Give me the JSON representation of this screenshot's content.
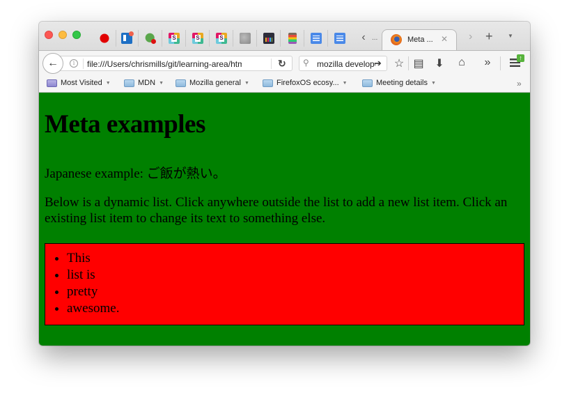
{
  "window": {
    "traffic_lights": [
      "close",
      "minimize",
      "maximize"
    ]
  },
  "tabs": {
    "pinned": [
      {
        "icon": "dinosaur-icon"
      },
      {
        "icon": "trello-icon"
      },
      {
        "icon": "bug-icon"
      },
      {
        "icon": "slack-icon"
      },
      {
        "icon": "slack-icon"
      },
      {
        "icon": "slack-icon"
      },
      {
        "icon": "globe-icon"
      },
      {
        "icon": "analytics-icon"
      },
      {
        "icon": "clipboard-icon"
      },
      {
        "icon": "docs-icon"
      },
      {
        "icon": "docs-icon"
      }
    ],
    "scroll_left": "‹",
    "overflow_ellipsis": "...",
    "active": {
      "title": "Meta ...",
      "close": "✕"
    },
    "scroll_right": "›",
    "new_tab": "+",
    "list_all": "▼"
  },
  "navbar": {
    "back": "←",
    "info": "i",
    "url": "file:///Users/chrismills/git/learning-area/html/introduction-to-html/the-html-head/meta-example.html",
    "reload": "↻",
    "search_icon": "⚲",
    "search_value": "mozilla developer network",
    "search_go": "➔",
    "bookmark_star": "☆",
    "reader": "▤",
    "downloads": "⬇",
    "home": "⌂",
    "overflow": "»",
    "update_badge": "↑"
  },
  "bookmarks": {
    "items": [
      {
        "label": "Most Visited",
        "type": "smart-folder"
      },
      {
        "label": "MDN",
        "type": "folder"
      },
      {
        "label": "Mozilla general",
        "type": "folder"
      },
      {
        "label": "FirefoxOS ecosy...",
        "type": "folder"
      },
      {
        "label": "Meeting details",
        "type": "folder"
      }
    ],
    "dropdown_arrow": "▼",
    "overflow": "»"
  },
  "page": {
    "background_color": "#008000",
    "heading": "Meta examples",
    "japanese_line": "Japanese example: ご飯が熱い。",
    "description": "Below is a dynamic list. Click anywhere outside the list to add a new list item. Click an existing list item to change its text to something else.",
    "list_background": "#ff0000",
    "list_items": [
      "This",
      "list is",
      "pretty",
      "awesome."
    ]
  }
}
